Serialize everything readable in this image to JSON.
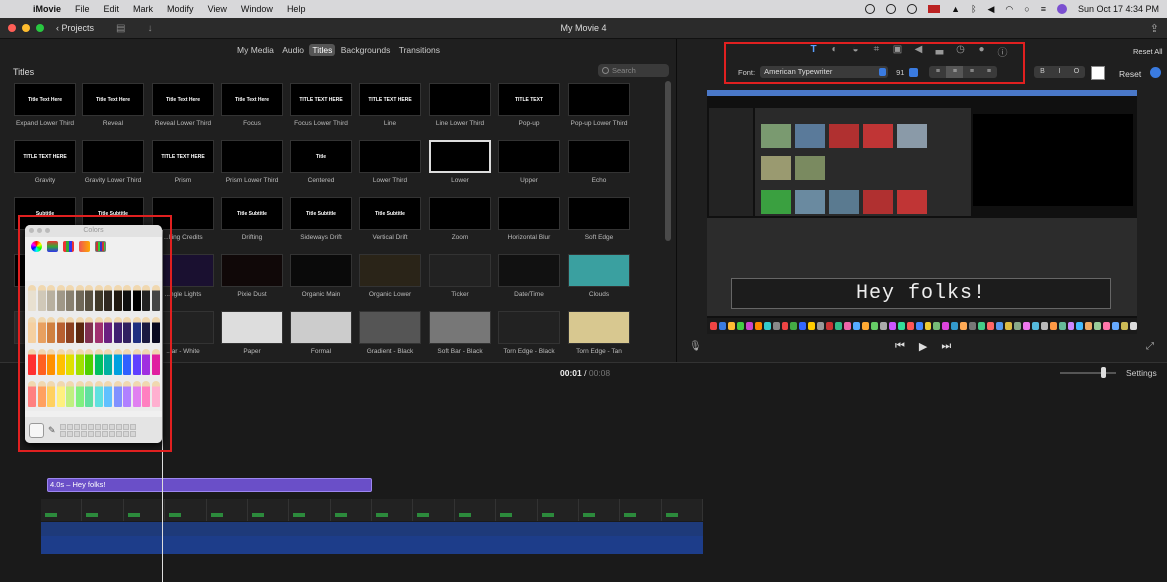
{
  "menubar": {
    "app_name": "iMovie",
    "menus": [
      "File",
      "Edit",
      "Mark",
      "Modify",
      "View",
      "Window",
      "Help"
    ],
    "clock": "Sun Oct 17  4:34 PM"
  },
  "toolbar": {
    "projects_label": "Projects",
    "window_title": "My Movie 4"
  },
  "browser": {
    "tabs": [
      "My Media",
      "Audio",
      "Titles",
      "Backgrounds",
      "Transitions"
    ],
    "selected_tab": "Titles",
    "section_title": "Titles",
    "search_placeholder": "Search",
    "titles": [
      {
        "label": "Expand Lower Third",
        "preview": "Title Text Here"
      },
      {
        "label": "Reveal",
        "preview": "Title Text Here"
      },
      {
        "label": "Reveal Lower Third",
        "preview": "Title Text Here"
      },
      {
        "label": "Focus",
        "preview": "Title Text Here"
      },
      {
        "label": "Focus Lower Third",
        "preview": "TITLE TEXT HERE"
      },
      {
        "label": "Line",
        "preview": "TITLE TEXT HERE"
      },
      {
        "label": "Line Lower Third",
        "preview": ""
      },
      {
        "label": "Pop-up",
        "preview": "TITLE TEXT"
      },
      {
        "label": "Pop-up Lower Third",
        "preview": ""
      },
      {
        "label": "Gravity",
        "preview": "TITLE TEXT HERE"
      },
      {
        "label": "Gravity Lower Third",
        "preview": ""
      },
      {
        "label": "Prism",
        "preview": "TITLE TEXT HERE"
      },
      {
        "label": "Prism Lower Third",
        "preview": ""
      },
      {
        "label": "Centered",
        "preview": "Title"
      },
      {
        "label": "Lower Third",
        "preview": ""
      },
      {
        "label": "Lower",
        "preview": ""
      },
      {
        "label": "Upper",
        "preview": ""
      },
      {
        "label": "Echo",
        "preview": ""
      },
      {
        "label": "",
        "preview": "Subtitle"
      },
      {
        "label": "",
        "preview": "Title Subtitle"
      },
      {
        "label": "...lling Credits",
        "preview": ""
      },
      {
        "label": "Drifting",
        "preview": "Title Subtitle"
      },
      {
        "label": "Sideways Drift",
        "preview": "Title Subtitle"
      },
      {
        "label": "Vertical Drift",
        "preview": "Title Subtitle"
      },
      {
        "label": "Zoom",
        "preview": ""
      },
      {
        "label": "Horizontal Blur",
        "preview": ""
      },
      {
        "label": "Soft Edge",
        "preview": ""
      },
      {
        "label": "",
        "preview": ""
      },
      {
        "label": "",
        "preview": ""
      },
      {
        "label": "...ngle Lights",
        "preview": ""
      },
      {
        "label": "Pixie Dust",
        "preview": ""
      },
      {
        "label": "Organic Main",
        "preview": ""
      },
      {
        "label": "Organic Lower",
        "preview": ""
      },
      {
        "label": "Ticker",
        "preview": ""
      },
      {
        "label": "Date/Time",
        "preview": ""
      },
      {
        "label": "Clouds",
        "preview": ""
      },
      {
        "label": "",
        "preview": ""
      },
      {
        "label": "",
        "preview": ""
      },
      {
        "label": "...ar - White",
        "preview": ""
      },
      {
        "label": "Paper",
        "preview": ""
      },
      {
        "label": "Formal",
        "preview": ""
      },
      {
        "label": "Gradient - Black",
        "preview": ""
      },
      {
        "label": "Soft Bar - Black",
        "preview": ""
      },
      {
        "label": "Torn Edge - Black",
        "preview": ""
      },
      {
        "label": "Torn Edge - Tan",
        "preview": ""
      }
    ],
    "selected_title": "Lower"
  },
  "viewer": {
    "reset_all_label": "Reset All",
    "font_label": "Font:",
    "font_value": "American Typewriter",
    "font_size": "91",
    "style_buttons": [
      "B",
      "I",
      "O"
    ],
    "reset_label": "Reset",
    "preview_text": "Hey folks!"
  },
  "colors_panel": {
    "title": "Colors"
  },
  "timeline": {
    "current_time": "00:01",
    "total_time": "00:08",
    "settings_label": "Settings",
    "title_clip_label": "4.0s – Hey folks!"
  },
  "colors": {
    "accent": "#3a7be0",
    "highlight_box": "#e02020",
    "title_clip": "#6a4fc8",
    "audio_track": "#1e3a7a"
  }
}
